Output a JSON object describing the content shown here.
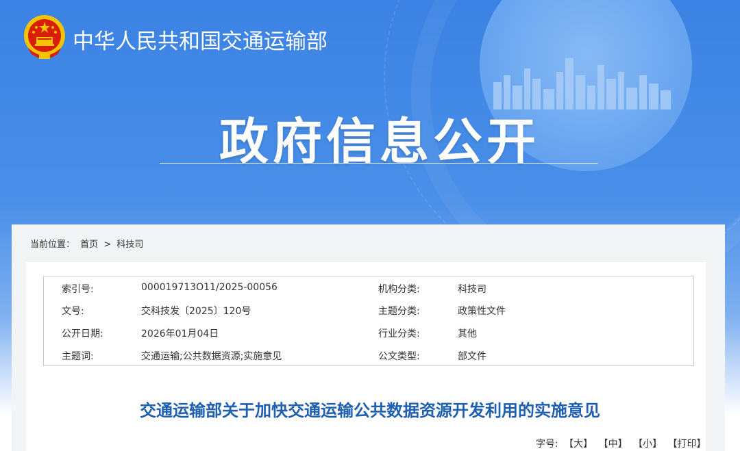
{
  "header": {
    "ministry_name": "中华人民共和国交通运输部",
    "section_title": "政府信息公开"
  },
  "breadcrumb": {
    "prefix": "当前位置：",
    "home": "首页",
    "separator": ">",
    "current": "科技司"
  },
  "metadata": {
    "rows": [
      {
        "label1": "索引号:",
        "value1": "000019713O11/2025-00056",
        "label2": "机构分类:",
        "value2": "科技司"
      },
      {
        "label1": "文号:",
        "value1": "交科技发〔2025〕120号",
        "label2": "主题分类:",
        "value2": "政策性文件"
      },
      {
        "label1": "公开日期:",
        "value1": "2026年01月04日",
        "label2": "行业分类:",
        "value2": "其他"
      },
      {
        "label1": "主题词:",
        "value1": "交通运输;公共数据资源;实施意见",
        "label2": "公文类型:",
        "value2": "部文件"
      }
    ]
  },
  "document": {
    "title": "交通运输部关于加快交通运输公共数据资源开发利用的实施意见"
  },
  "font_controls": {
    "label": "字号:",
    "large": "【大】",
    "medium": "【中】",
    "small": "【小】",
    "print": "【打印】"
  },
  "colors": {
    "banner_blue": "#3b82e4",
    "title_blue": "#1f5fb0",
    "emblem_red": "#d81e06",
    "emblem_gold": "#f5c400"
  },
  "icons": {
    "emblem": "national-emblem-icon"
  }
}
